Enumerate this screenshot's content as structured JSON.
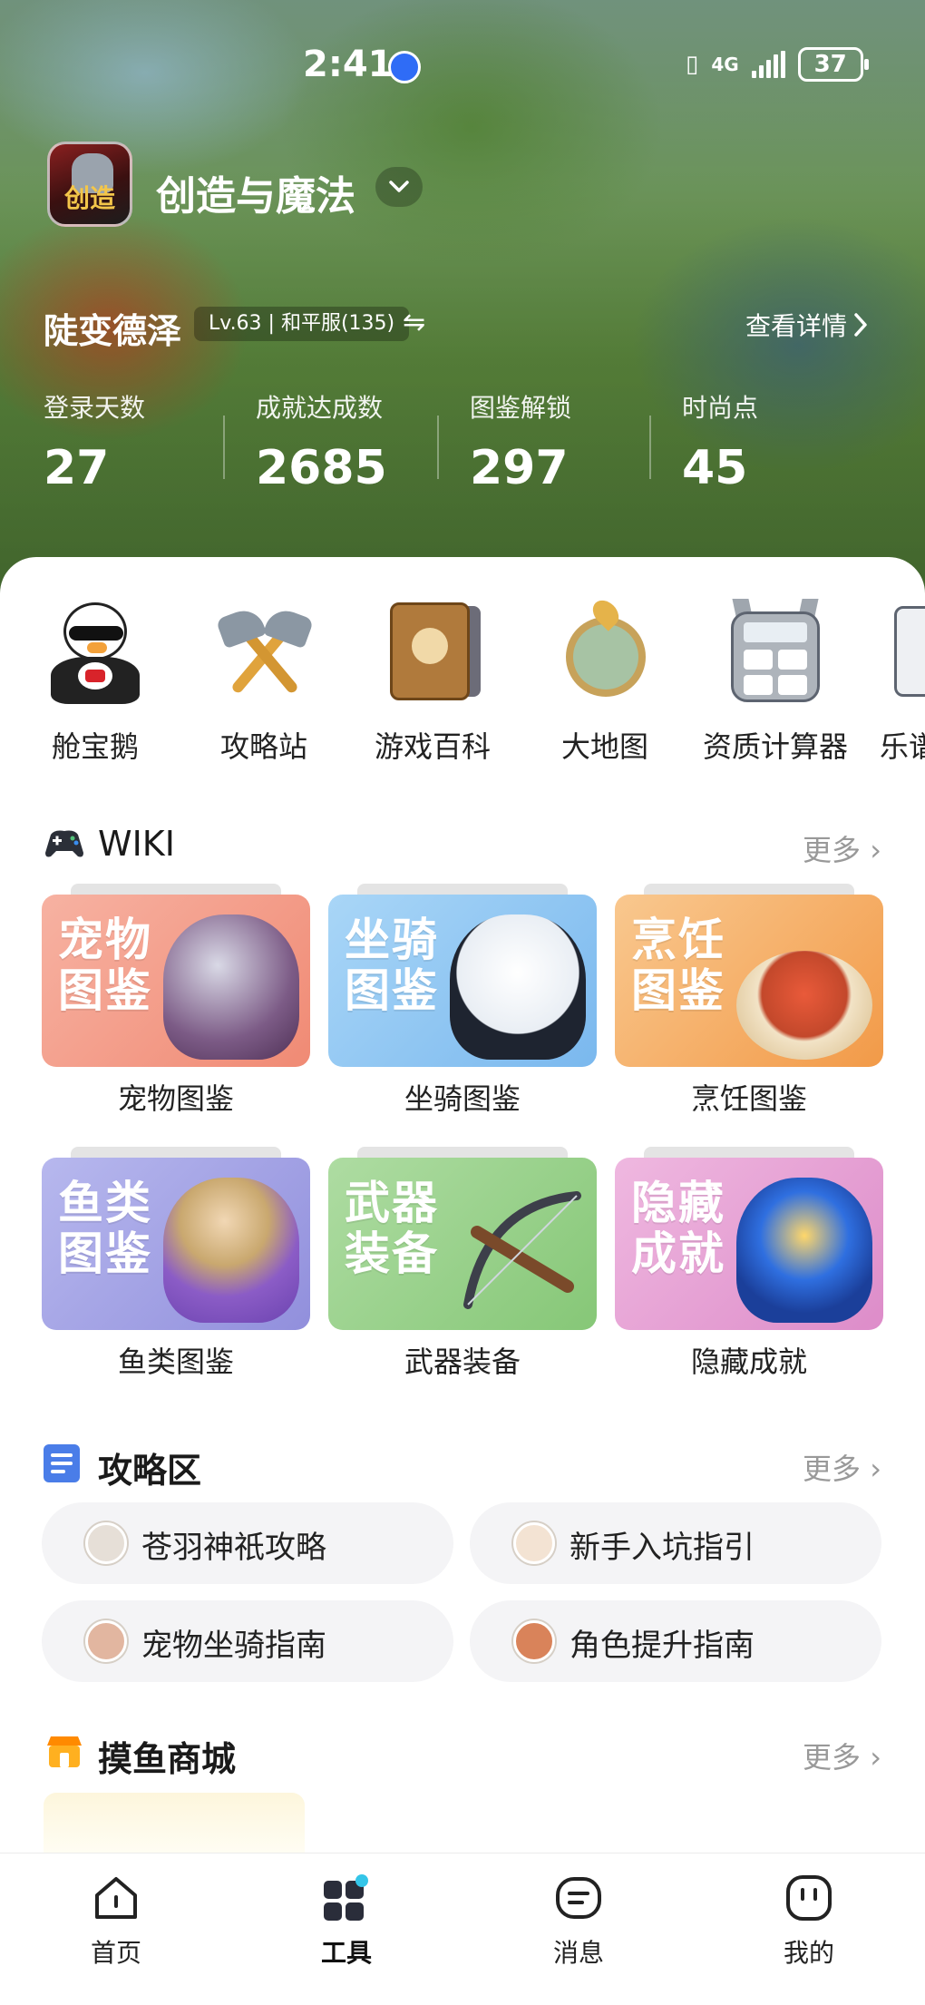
{
  "status_bar": {
    "time": "2:41",
    "network": "4G",
    "battery": "37"
  },
  "header": {
    "game_logo_text": "创造",
    "game_name": "创造与魔法",
    "player_name": "陡变德泽",
    "player_tag": "Lv.63 | 和平服(135)",
    "detail_link": "查看详情"
  },
  "stats": [
    {
      "label": "登录天数",
      "value": "27"
    },
    {
      "label": "成就达成数",
      "value": "2685"
    },
    {
      "label": "图鉴解锁",
      "value": "297"
    },
    {
      "label": "时尚点",
      "value": "45"
    }
  ],
  "quick_tools": [
    {
      "label": "舱宝鹅",
      "icon": "goose-mascot-icon"
    },
    {
      "label": "攻略站",
      "icon": "crossed-axes-icon"
    },
    {
      "label": "游戏百科",
      "icon": "encyclopedia-book-icon"
    },
    {
      "label": "大地图",
      "icon": "world-map-icon"
    },
    {
      "label": "资质计算器",
      "icon": "calculator-icon"
    },
    {
      "label": "乐谱",
      "icon": "music-sheet-icon"
    }
  ],
  "wiki": {
    "title": "WIKI",
    "more": "更多",
    "cards": [
      {
        "art_line1": "宠物",
        "art_line2": "图鉴",
        "caption": "宠物图鉴"
      },
      {
        "art_line1": "坐骑",
        "art_line2": "图鉴",
        "caption": "坐骑图鉴"
      },
      {
        "art_line1": "烹饪",
        "art_line2": "图鉴",
        "caption": "烹饪图鉴"
      },
      {
        "art_line1": "鱼类",
        "art_line2": "图鉴",
        "caption": "鱼类图鉴"
      },
      {
        "art_line1": "武器",
        "art_line2": "装备",
        "caption": "武器装备"
      },
      {
        "art_line1": "隐藏",
        "art_line2": "成就",
        "caption": "隐藏成就"
      }
    ]
  },
  "guides": {
    "title": "攻略区",
    "more": "更多",
    "items": [
      {
        "label": "苍羽神祇攻略"
      },
      {
        "label": "新手入坑指引"
      },
      {
        "label": "宠物坐骑指南"
      },
      {
        "label": "角色提升指南"
      }
    ]
  },
  "shop": {
    "title": "摸鱼商城",
    "more": "更多"
  },
  "bottom_nav": [
    {
      "label": "首页"
    },
    {
      "label": "工具"
    },
    {
      "label": "消息"
    },
    {
      "label": "我的"
    }
  ],
  "colors": {
    "card_pet": "#f49a86",
    "card_mount": "#8fc7f4",
    "card_cooking": "#f6b26b",
    "card_fish": "#a9a7e6",
    "card_weapon": "#9bd38e",
    "card_achieve": "#e9a5d6"
  }
}
